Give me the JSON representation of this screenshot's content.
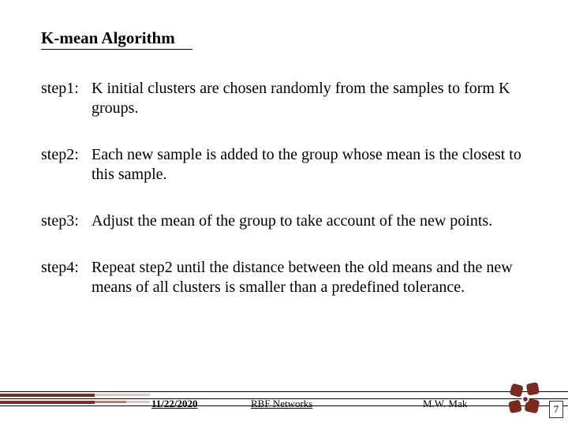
{
  "title": "K-mean Algorithm",
  "steps": [
    {
      "label": "step1:",
      "text": "K initial clusters are chosen randomly from the samples to form K  groups."
    },
    {
      "label": "step2:",
      "text": "Each new sample is added to the group whose mean is the closest to this sample."
    },
    {
      "label": "step3:",
      "text": "Adjust the mean of the group to take account of the new points."
    },
    {
      "label": "step4:",
      "text": "Repeat step2 until the distance between the old means and the new means of all clusters is smaller than a predefined tolerance."
    }
  ],
  "footer": {
    "date": "11/22/2020",
    "center": "RBF Networks",
    "author": "M.W. Mak",
    "page": "7"
  }
}
